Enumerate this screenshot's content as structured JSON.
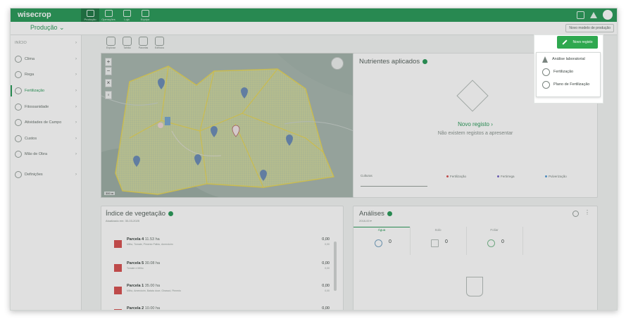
{
  "app": {
    "logo": "wisecrop"
  },
  "topnav": [
    {
      "label": "Produção"
    },
    {
      "label": "Operações"
    },
    {
      "label": "Loja"
    },
    {
      "label": "Equipa"
    }
  ],
  "subbar": {
    "production": "Produção ⌄",
    "new_production": "Novo modelo de produção"
  },
  "sidebar": {
    "items": [
      {
        "label": "INÍCIO"
      },
      {
        "label": "Clima"
      },
      {
        "label": "Rega"
      },
      {
        "label": "Fertilização"
      },
      {
        "label": "Fitossanidade"
      },
      {
        "label": "Atividades de Campo"
      },
      {
        "label": "Custos"
      },
      {
        "label": "Mão de Obra"
      },
      {
        "label": "Definições"
      }
    ]
  },
  "maptools": [
    {
      "label": "Explorar"
    },
    {
      "label": "Talhão"
    },
    {
      "label": "Parcelas"
    },
    {
      "label": "Edifícios"
    }
  ],
  "map": {
    "zoom_in": "+",
    "zoom_out": "−",
    "scale": "300 m"
  },
  "nutrients": {
    "title": "Nutrientes aplicados",
    "new_link": "Novo registo ›",
    "empty": "Não existem registos a apresentar",
    "crops_label": "Culturas",
    "legend": [
      {
        "label": "Fertilização",
        "color": "#d95555"
      },
      {
        "label": "Fertirrega",
        "color": "#7b6cc9"
      },
      {
        "label": "Pulverização",
        "color": "#5aa0d8"
      }
    ]
  },
  "vegetation": {
    "title": "Índice de vegetação",
    "subtitle": "Atualizado em: 30-03-2025",
    "parcels": [
      {
        "name": "Parcela 4",
        "area": "11.53 ha",
        "desc": "Milho, Tomate, Pimento Pálido, Amendoim",
        "value": "0,00",
        "value2": "0,00"
      },
      {
        "name": "Parcela 5",
        "area": "30.08 ha",
        "desc": "Tomate e Milho",
        "value": "0,00",
        "value2": "0,00"
      },
      {
        "name": "Parcela 1",
        "area": "35.00 ha",
        "desc": "Milho, Amendoim, Batata doce, Girassol, Pimento",
        "value": "0,00",
        "value2": "0,00"
      },
      {
        "name": "Parcela 2",
        "area": "10.00 ha",
        "desc": "",
        "value": "0,00",
        "value2": ""
      }
    ]
  },
  "analyses": {
    "title": "Análises",
    "subtitle": "2018-00 ▾",
    "tabs": [
      {
        "label": "Água",
        "count": "0"
      },
      {
        "label": "Solo",
        "count": "0"
      },
      {
        "label": "Foliar",
        "count": "0"
      }
    ]
  },
  "new_record": {
    "button": "Novo registo",
    "menu": [
      {
        "label": "Análise laboratorial",
        "icon": "flask-icon"
      },
      {
        "label": "Fertilização",
        "icon": "fertilization-icon"
      },
      {
        "label": "Plano de Fertilização",
        "icon": "plan-icon"
      }
    ]
  }
}
